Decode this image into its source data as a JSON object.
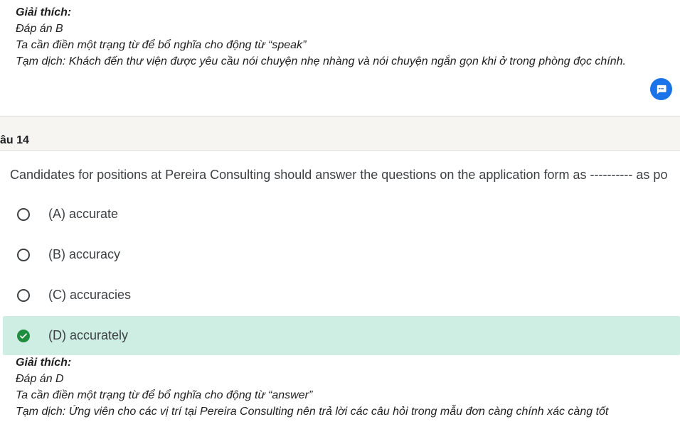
{
  "prev_explanation": {
    "title": "Giải thích:",
    "answer": "Đáp án B",
    "reason": "Ta cần điền một trạng từ để bổ nghĩa cho động từ “speak”",
    "translation": "Tạm dịch: Khách đến thư viện được yêu cầu nói chuyện nhẹ nhàng và nói chuyện ngắn gọn khi ở trong phòng đọc chính."
  },
  "chat_button": {
    "icon": "chat-bubble-icon",
    "color": "#1a73e8"
  },
  "question": {
    "number": "âu 14",
    "text": "Candidates for positions at Pereira Consulting should answer the questions on the application form as ---------- as po",
    "options": [
      {
        "label": "(A) accurate",
        "state": "unselected"
      },
      {
        "label": "(B) accuracy",
        "state": "unselected"
      },
      {
        "label": "(C) accuracies",
        "state": "unselected"
      },
      {
        "label": "(D) accurately",
        "state": "correct"
      }
    ]
  },
  "explanation": {
    "title": "Giải thích:",
    "answer": "Đáp án D",
    "reason": "Ta cần điền một trạng từ để bổ nghĩa cho động từ “answer”",
    "translation": "Tạm dịch: Ứng viên cho các vị trí tại Pereira Consulting nên trả lời các câu hỏi trong mẫu đơn càng chính xác càng tốt"
  },
  "colors": {
    "correct_background": "#cfeee3",
    "correct_check": "#1e8e3e",
    "divider_band": "#f6f5f2"
  }
}
